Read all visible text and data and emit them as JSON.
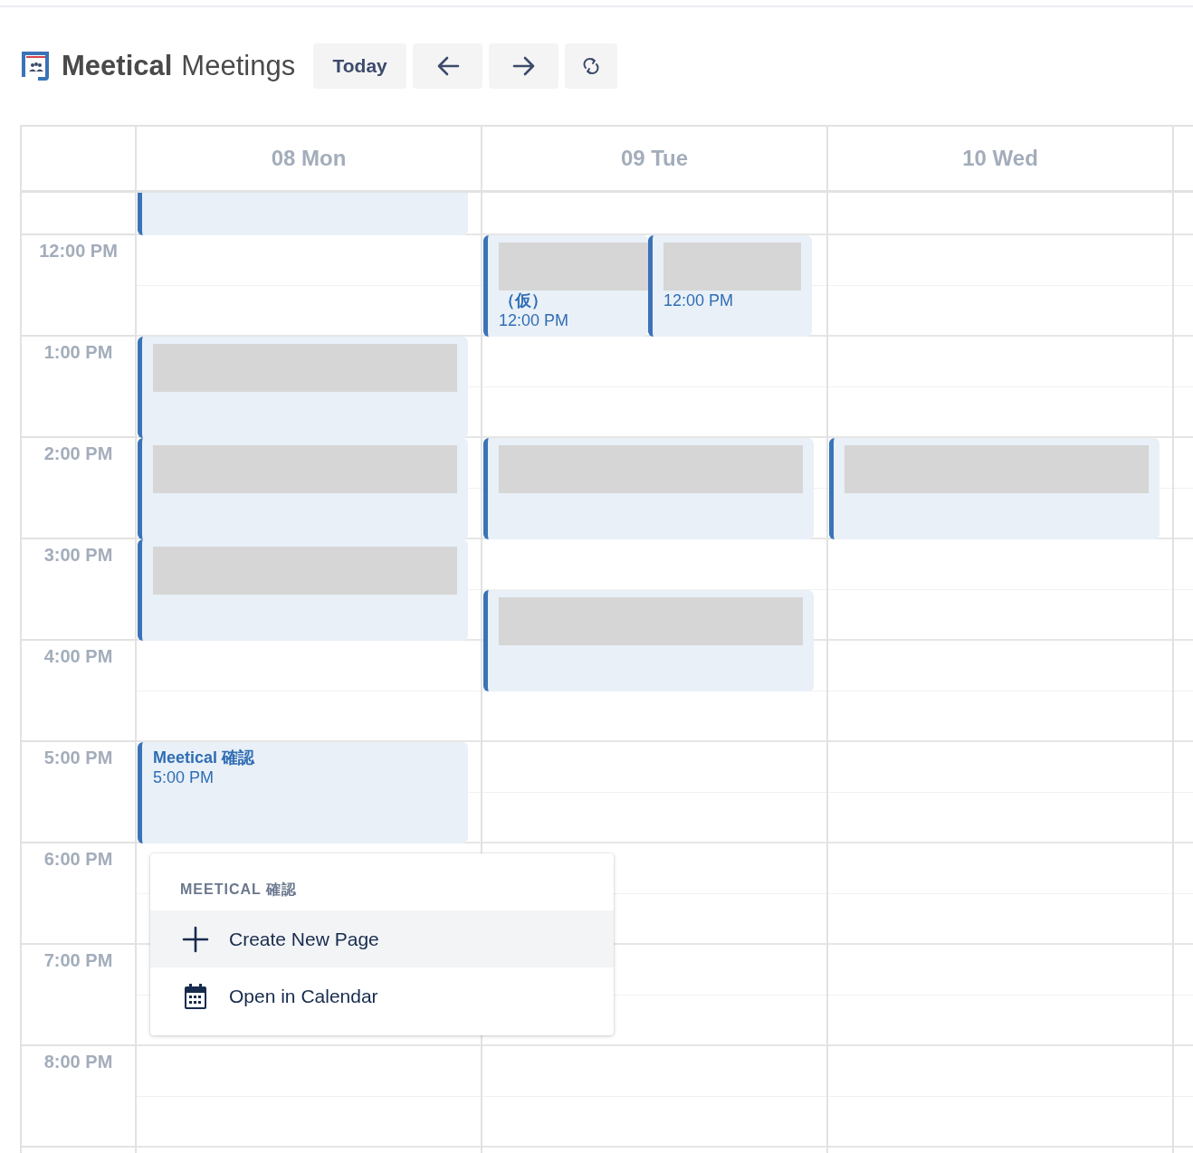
{
  "app": {
    "brand": "Meetical",
    "title": "Meetings"
  },
  "toolbar": [
    {
      "kind": "text",
      "label": "Today"
    },
    {
      "kind": "prev"
    },
    {
      "kind": "next"
    },
    {
      "kind": "refresh"
    }
  ],
  "days": [
    {
      "label": "08 Mon",
      "events": [
        {
          "redacted": false
        },
        {
          "redacted": true
        },
        {
          "redacted": true
        },
        {
          "redacted": true
        },
        {
          "redacted": false,
          "title": "Meetical 確認",
          "time": "5:00 PM"
        }
      ]
    },
    {
      "label": "09 Tue",
      "events": [
        {
          "redacted": true,
          "title": "（仮）",
          "time": "12:00 PM"
        },
        {
          "redacted": true,
          "time": "12:00 PM"
        },
        {
          "redacted": true
        },
        {
          "redacted": true
        }
      ]
    },
    {
      "label": "10 Wed",
      "events": [
        {
          "redacted": true
        }
      ]
    }
  ],
  "times": [
    "12:00 PM",
    "1:00 PM",
    "2:00 PM",
    "3:00 PM",
    "4:00 PM",
    "5:00 PM",
    "6:00 PM",
    "7:00 PM",
    "8:00 PM"
  ],
  "menu": {
    "heading": "MEETICAL 確認",
    "items": [
      {
        "kind": "create",
        "label": "Create New Page",
        "selected": true
      },
      {
        "kind": "calendar",
        "label": "Open in Calendar",
        "selected": false
      }
    ]
  }
}
